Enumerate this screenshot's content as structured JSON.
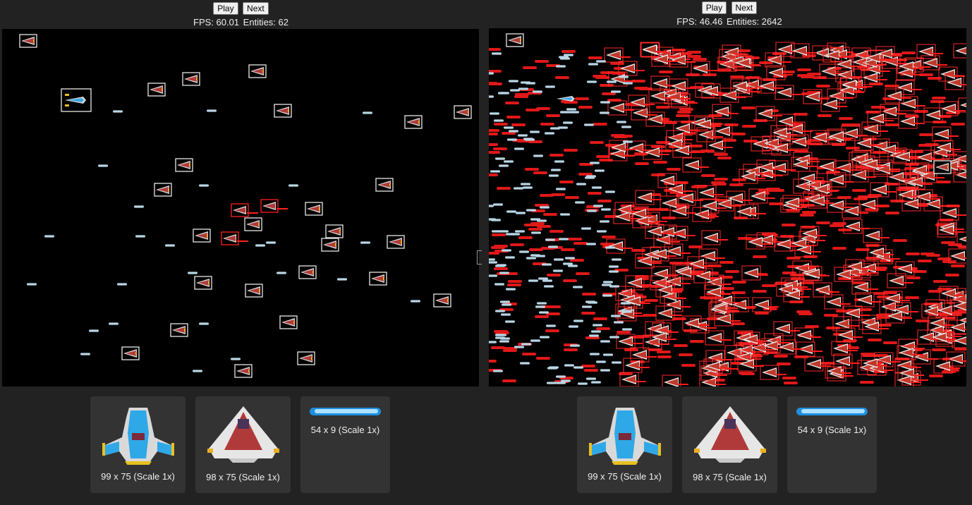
{
  "left": {
    "play_label": "Play",
    "next_label": "Next",
    "fps": "FPS: 60.01",
    "entities": "Entities: 62",
    "sprites": [
      {
        "size_label": "99 x 75 (Scale 1x)",
        "icon": "player-ship-icon"
      },
      {
        "size_label": "98 x 75 (Scale 1x)",
        "icon": "enemy-ship-icon"
      },
      {
        "size_label": "54 x 9 (Scale 1x)",
        "icon": "laser-icon"
      }
    ]
  },
  "right": {
    "play_label": "Play",
    "next_label": "Next",
    "fps": "FPS: 46.46",
    "entities": "Entities: 2642",
    "sprites": [
      {
        "size_label": "99 x 75 (Scale 1x)",
        "icon": "player-ship-icon"
      },
      {
        "size_label": "98 x 75 (Scale 1x)",
        "icon": "enemy-ship-icon"
      },
      {
        "size_label": "54 x 9 (Scale 1x)",
        "icon": "laser-icon"
      }
    ]
  },
  "colors": {
    "background": "#222222",
    "viewport": "#000000",
    "card": "#333333",
    "collision_box": "#ff2020",
    "laser": "#b9d6e6",
    "enemy_body": "#b03a3a"
  }
}
